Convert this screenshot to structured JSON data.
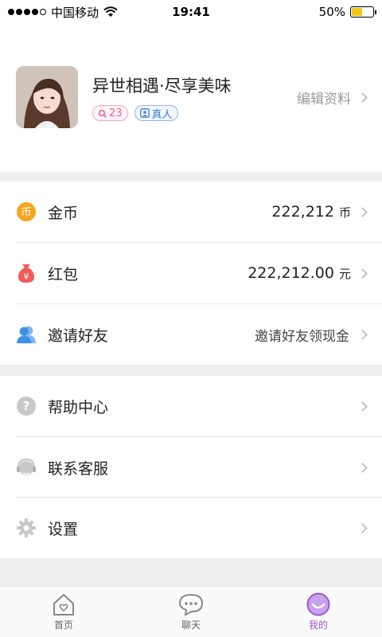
{
  "status_bar": {
    "carrier": "中国移动",
    "time": "19:41",
    "battery": "50%",
    "battery_level": 0.5
  },
  "profile": {
    "nickname": "异世相遇·尽享美味",
    "age": "23",
    "verified_label": "真人",
    "edit_label": "编辑资料"
  },
  "wallet": {
    "coins_label": "金币",
    "coins_value": "222,212",
    "coins_unit": "币",
    "redpacket_label": "红包",
    "redpacket_value": "222,212.00",
    "redpacket_unit": "元",
    "invite_label": "邀请好友",
    "invite_hint": "邀请好友领现金"
  },
  "menu": {
    "help_label": "帮助中心",
    "service_label": "联系客服",
    "settings_label": "设置"
  },
  "tabs": {
    "home": "首页",
    "chat": "聊天",
    "mine": "我的"
  },
  "colors": {
    "accent": "#9b59d6",
    "coin": "#f5a623",
    "redpacket": "#f05a5a",
    "invite": "#3d8fe8"
  }
}
